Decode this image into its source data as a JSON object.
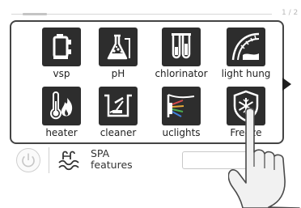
{
  "pagination": {
    "label": "1 / 2"
  },
  "tiles": [
    {
      "label": "vsp",
      "icon": "vsp-pump-icon"
    },
    {
      "label": "pH",
      "icon": "ph-flask-icon"
    },
    {
      "label": "chlorinator",
      "icon": "chlorinator-tubes-icon"
    },
    {
      "label": "light hung",
      "icon": "light-hung-arch-icon"
    },
    {
      "label": "heater",
      "icon": "heater-thermometer-flame-icon"
    },
    {
      "label": "cleaner",
      "icon": "pool-cleaner-icon"
    },
    {
      "label": "uclights",
      "icon": "uclights-icon"
    },
    {
      "label": "Freeze",
      "icon": "freeze-snowflake-shield-icon"
    }
  ],
  "spa": {
    "line1": "SPA",
    "line2": "features"
  },
  "colors": {
    "icon_bg": "#2d2d2d",
    "border": "#444444"
  }
}
